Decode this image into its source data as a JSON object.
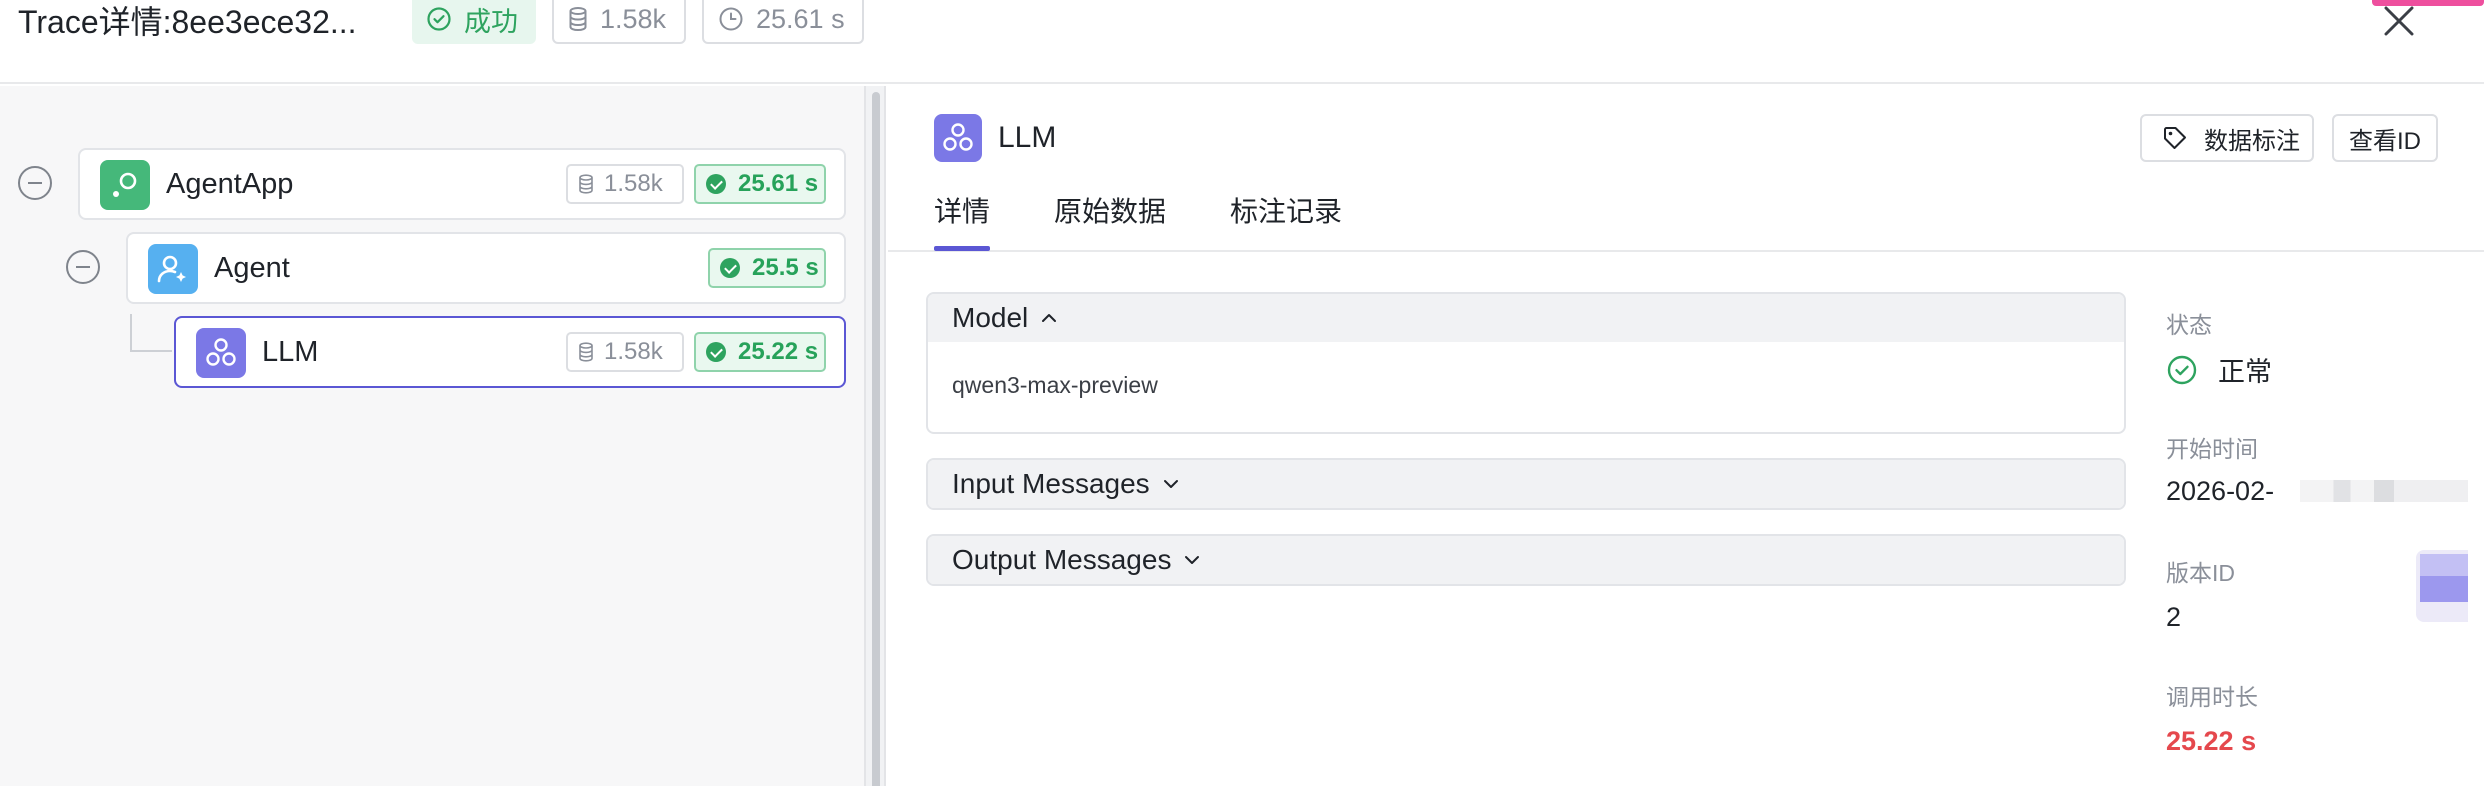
{
  "header": {
    "title": "Trace详情:8ee3ece32...",
    "status": "成功",
    "tokens": "1.58k",
    "duration": "25.61 s"
  },
  "tree": {
    "nodes": [
      {
        "label": "AgentApp",
        "tokens": "1.58k",
        "time": "25.61 s",
        "icon": "agent-app-icon"
      },
      {
        "label": "Agent",
        "time": "25.5 s",
        "icon": "agent-icon"
      },
      {
        "label": "LLM",
        "tokens": "1.58k",
        "time": "25.22 s",
        "icon": "llm-icon",
        "selected": true
      }
    ]
  },
  "detail": {
    "title": "LLM",
    "annotate_button": "数据标注",
    "view_id_button": "查看ID",
    "tabs": [
      {
        "label": "详情",
        "active": true
      },
      {
        "label": "原始数据"
      },
      {
        "label": "标注记录"
      }
    ],
    "sections": {
      "model": {
        "title": "Model",
        "value": "qwen3-max-preview",
        "expanded": true
      },
      "input": {
        "title": "Input Messages",
        "expanded": false
      },
      "output": {
        "title": "Output Messages",
        "expanded": false
      }
    },
    "meta": {
      "status_label": "状态",
      "status_value": "正常",
      "start_label": "开始时间",
      "start_value": "2026-02-",
      "version_label": "版本ID",
      "version_value": "2",
      "call_label": "调用时长",
      "call_value": "25.22 s"
    }
  },
  "colors": {
    "accent": "#5b57d4",
    "success": "#2ea35f",
    "danger": "#e5484d"
  }
}
